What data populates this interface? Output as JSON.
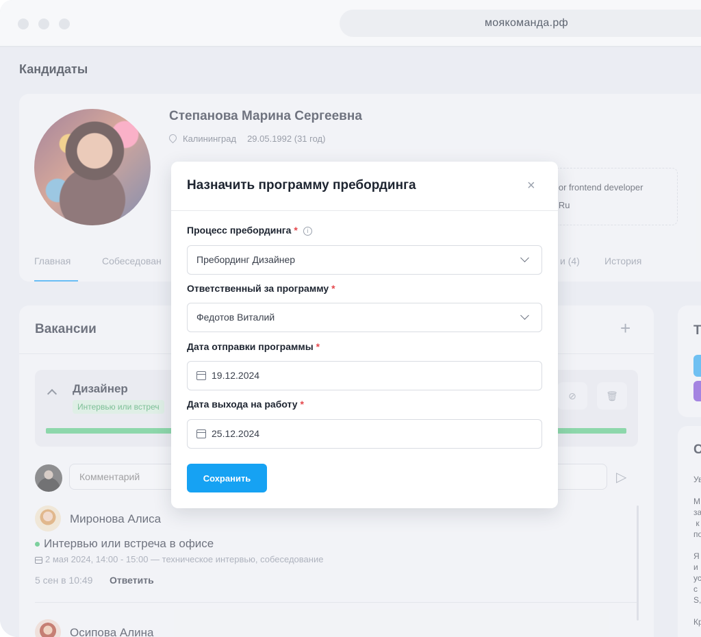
{
  "browser": {
    "url": "моякоманда.рф"
  },
  "page": {
    "title": "Кандидаты"
  },
  "candidate": {
    "name": "Степанова Марина Сергеевна",
    "city": "Калининград",
    "birth": "29.05.1992 (31 год)",
    "job_line1": "ior frontend developer",
    "job_line2": "lRu"
  },
  "tabs": {
    "main": "Главная",
    "interviews": "Собеседован",
    "other": "и (4)",
    "history": "История"
  },
  "vacancies": {
    "title": "Вакансии",
    "add": "+",
    "item": {
      "name": "Дизайнер",
      "status": "Интервью или встреч"
    }
  },
  "comment": {
    "placeholder": "Комментарий"
  },
  "feed": [
    {
      "author": "Миронова Алиса",
      "event": "Интервью или встреча в офисе",
      "details": "2 мая 2024, 14:00 - 15:00 — техническое интервью, собеседование",
      "time": "5 сен в 10:49",
      "reply": "Ответить"
    },
    {
      "author": "Осипова Алина"
    }
  ],
  "right_panel": {
    "card1_letter": "Т",
    "card2_letter": "С",
    "card2_text": "Ув\n\nМ\nза\n к\nпо\n\nЯ\nи\nус\nс\nS,\n\nКр"
  },
  "modal": {
    "title": "Назначить программу пребординга",
    "close": "×",
    "fields": [
      {
        "label": "Процесс пребординга",
        "value": "Пребординг Дизайнер",
        "type": "select"
      },
      {
        "label": "Ответственный за программу",
        "value": "Федотов Виталий",
        "type": "select"
      },
      {
        "label": "Дата отправки программы",
        "value": "19.12.2024",
        "type": "date"
      },
      {
        "label": "Дата выхода на работу",
        "value": "25.12.2024",
        "type": "date"
      }
    ],
    "required_mark": "*",
    "info_mark": "i",
    "save": "Сохранить"
  },
  "colors": {
    "accent": "#16a2f3",
    "success": "#58c983",
    "required": "#e5484d",
    "purple": "#7b4bd6"
  }
}
